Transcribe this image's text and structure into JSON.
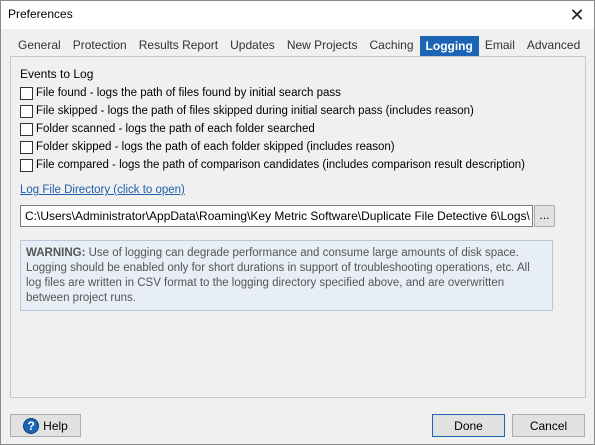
{
  "window": {
    "title": "Preferences",
    "close_glyph": "✕"
  },
  "tabs": [
    {
      "label": "General",
      "active": false
    },
    {
      "label": "Protection",
      "active": false
    },
    {
      "label": "Results Report",
      "active": false
    },
    {
      "label": "Updates",
      "active": false
    },
    {
      "label": "New Projects",
      "active": false
    },
    {
      "label": "Caching",
      "active": false
    },
    {
      "label": "Logging",
      "active": true
    },
    {
      "label": "Email",
      "active": false
    },
    {
      "label": "Advanced",
      "active": false
    }
  ],
  "logging": {
    "section_label": "Events to Log",
    "events": [
      {
        "label": "File found - logs the path of files found by initial search pass",
        "checked": false
      },
      {
        "label": "File skipped - logs the path of files skipped during initial search pass (includes reason)",
        "checked": false
      },
      {
        "label": "Folder scanned - logs the path of each folder searched",
        "checked": false
      },
      {
        "label": "Folder skipped - logs the path of each folder skipped (includes reason)",
        "checked": false
      },
      {
        "label": "File compared - logs the path of comparison candidates (includes comparison result description)",
        "checked": false
      }
    ],
    "log_dir_link": "Log File Directory (click to open)",
    "log_dir_value": "C:\\Users\\Administrator\\AppData\\Roaming\\Key Metric Software\\Duplicate File Detective 6\\Logs\\",
    "browse_label": "...",
    "warning_title": "WARNING:",
    "warning_text": " Use of logging can degrade performance and consume large amounts of disk space. Logging should be enabled only for short durations in support of troubleshooting operations, etc. All log files are written in CSV format to the logging directory specified above, and are overwritten between project runs."
  },
  "footer": {
    "help_label": "Help",
    "help_icon": "question-circle",
    "done_label": "Done",
    "cancel_label": "Cancel"
  },
  "colors": {
    "accent": "#1c64b4",
    "link": "#1f5fa8",
    "warning_bg": "#e8eef6"
  }
}
